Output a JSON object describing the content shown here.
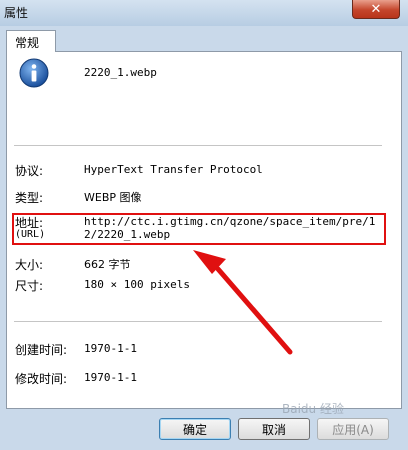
{
  "window": {
    "title": "属性",
    "close_glyph": "✕"
  },
  "tab": {
    "label": "常规"
  },
  "file": {
    "name": "2220_1.webp",
    "icon": "info-icon"
  },
  "properties": {
    "protocol_label": "协议:",
    "protocol_value": "HyperText Transfer Protocol",
    "type_label": "类型:",
    "type_value": "WEBP 图像",
    "address_label": "地址:",
    "address_sublabel": "(URL)",
    "address_value": "http://ctc.i.gtimg.cn/qzone/space_item/pre/12/2220_1.webp",
    "size_label": "大小:",
    "size_value": "662 字节",
    "dimensions_label": "尺寸:",
    "dimensions_value": "180 × 100 pixels",
    "created_label": "创建时间:",
    "created_value": "1970-1-1",
    "modified_label": "修改时间:",
    "modified_value": "1970-1-1"
  },
  "buttons": {
    "ok": "确定",
    "cancel": "取消",
    "apply": "应用(A)"
  },
  "annotation": {
    "color": "#e01010"
  },
  "watermark": "Baidu 经验"
}
